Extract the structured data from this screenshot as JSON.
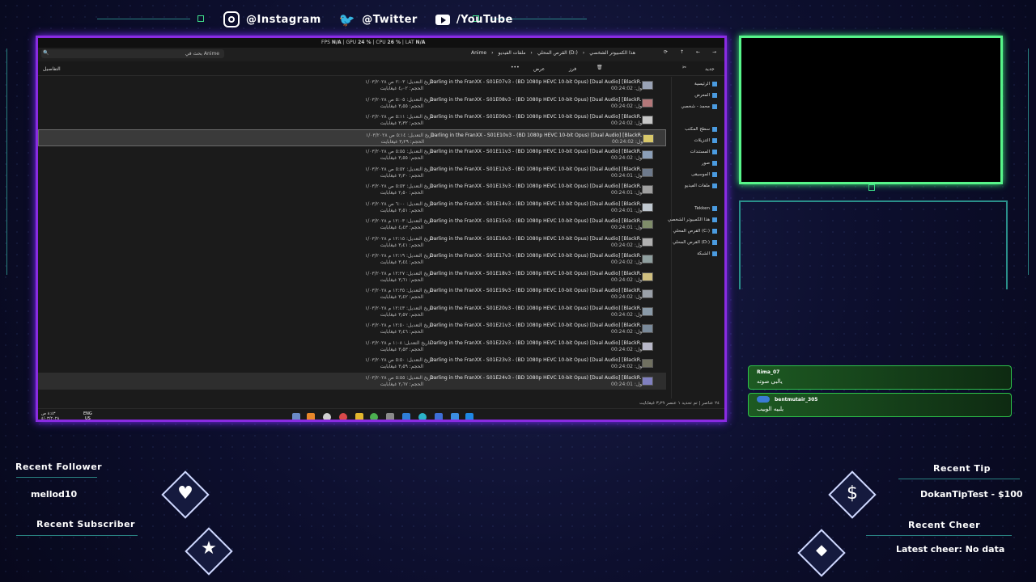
{
  "social": {
    "instagram": "@Instagram",
    "twitter": "@Twitter",
    "youtube": "/YouTube"
  },
  "overlay_colors": {
    "accent_purple": "#8a2be2",
    "accent_green": "#57f58a",
    "chat_green": "#2ec24a"
  },
  "perf": {
    "fps_label": "FPS",
    "fps": "N/A",
    "gpu_label": "GPU",
    "gpu": "24 %",
    "cpu_label": "CPU",
    "cpu": "26 %",
    "lat_label": "LAT",
    "lat": "N/A"
  },
  "explorer": {
    "search_placeholder": "بحث في Anime",
    "breadcrumb": [
      "هذا الكمبيوتر الشخصي",
      "القرص المحلي (D:)",
      "ملفات الفيديو",
      "Anime"
    ],
    "toolbar": {
      "new": "جديد",
      "sort": "فرز",
      "view": "عرض",
      "details": "التفاصيل"
    },
    "rows": [
      {
        "name": "Darling in the FranXX - S01E07v3 - (BD 1080p HEVC 10-bit Opus) [Dual Audio] [BlackR...",
        "len": "الطول: 00:24:02",
        "date": "تاريخ التعديل: ٢:٠٣ ص ١/٠٣/٢٠٢٨",
        "size": "الحجم: ٤٫٠٢ غيغابايت"
      },
      {
        "name": "Darling in the FranXX - S01E08v3 - (BD 1080p HEVC 10-bit Opus) [Dual Audio] [BlackR...",
        "len": "الطول: 00:24:02",
        "date": "تاريخ التعديل: ٥:٠٥ ص ١/٠٣/٢٠٢٨",
        "size": "الحجم: ٣٫٥٥ غيغابايت"
      },
      {
        "name": "Darling in the FranXX - S01E09v3 - (BD 1080p HEVC 10-bit Opus) [Dual Audio] [BlackR...",
        "len": "الطول: 00:24:02",
        "date": "تاريخ التعديل: ٥:١١ ص ١/٠٣/٢٠٢٨",
        "size": "الحجم: ٣٫٣٢ غيغابايت"
      },
      {
        "name": "Darling in the FranXX - S01E10v3 - (BD 1080p HEVC 10-bit Opus) [Dual Audio] [BlackR...",
        "len": "الطول: 00:24:02",
        "date": "تاريخ التعديل: ٥:١٤ ص ١/٠٣/٢٠٢٨",
        "size": "الحجم: ٣٫٢٩ غيغابايت",
        "selected": true
      },
      {
        "name": "Darling in the FranXX - S01E11v3 - (BD 1080p HEVC 10-bit Opus) [Dual Audio] [BlackR...",
        "len": "الطول: 00:24:02",
        "date": "تاريخ التعديل: ٥:٥٥ ص ١/٠٣/٢٠٢٨",
        "size": "الحجم: ٣٫٥٥ غيغابايت"
      },
      {
        "name": "Darling in the FranXX - S01E12v3 - (BD 1080p HEVC 10-bit Opus) [Dual Audio] [BlackR...",
        "len": "الطول: 00:24:01",
        "date": "تاريخ التعديل: ٥:٥٢ ص ١/٠٣/٢٠٢٨",
        "size": "الحجم: ٣٫٣٠ غيغابايت"
      },
      {
        "name": "Darling in the FranXX - S01E13v3 - (BD 1080p HEVC 10-bit Opus) [Dual Audio] [BlackR...",
        "len": "الطول: 00:24:01",
        "date": "تاريخ التعديل: ٥:٥٣ ص ١/٠٣/٢٠٢٨",
        "size": "الحجم: ٢٫٥٠ غيغابايت"
      },
      {
        "name": "Darling in the FranXX - S01E14v3 - (BD 1080p HEVC 10-bit Opus) [Dual Audio] [BlackR...",
        "len": "الطول: 00:24:01",
        "date": "تاريخ التعديل: ٦:٠٠ ص ١/٠٣/٢٠٢٨",
        "size": "الحجم: ٣٫٥١ غيغابايت"
      },
      {
        "name": "Darling in the FranXX - S01E15v3 - (BD 1080p HEVC 10-bit Opus) [Dual Audio] [BlackR...",
        "len": "الطول: 00:24:01",
        "date": "تاريخ التعديل: ١٢:٠٣ م ١/٠٣/٢٠٢٨",
        "size": "الحجم: ٤٫٤٣ غيغابايت"
      },
      {
        "name": "Darling in the FranXX - S01E16v3 - (BD 1080p HEVC 10-bit Opus) [Dual Audio] [BlackR...",
        "len": "الطول: 00:24:02",
        "date": "تاريخ التعديل: ١٢:١٥ م ١/٠٣/٢٠٢٨",
        "size": "الحجم: ٣٫٤١ غيغابايت"
      },
      {
        "name": "Darling in the FranXX - S01E17v3 - (BD 1080p HEVC 10-bit Opus) [Dual Audio] [BlackR...",
        "len": "الطول: 00:24:02",
        "date": "تاريخ التعديل: ١٢:١٩ م ١/٠٣/٢٠٢٨",
        "size": "الحجم: ٣٫٤٤ غيغابايت"
      },
      {
        "name": "Darling in the FranXX - S01E18v3 - (BD 1080p HEVC 10-bit Opus) [Dual Audio] [BlackR...",
        "len": "الطول: 00:24:02",
        "date": "تاريخ التعديل: ١٢:٢٧ م ١/٠٣/٢٠٢٨",
        "size": "الحجم: ٣٫٦١ غيغابايت"
      },
      {
        "name": "Darling in the FranXX - S01E19v3 - (BD 1080p HEVC 10-bit Opus) [Dual Audio] [BlackR...",
        "len": "الطول: 00:24:02",
        "date": "تاريخ التعديل: ١٢:٣٥ م ١/٠٣/٢٠٢٨",
        "size": "الحجم: ٣٫٤٢ غيغابايت"
      },
      {
        "name": "Darling in the FranXX - S01E20v3 - (BD 1080p HEVC 10-bit Opus) [Dual Audio] [BlackR...",
        "len": "الطول: 00:24:02",
        "date": "تاريخ التعديل: ١٢:٤٣ م ١/٠٣/٢٠٢٨",
        "size": "الحجم: ٣٫٥٧ غيغابايت"
      },
      {
        "name": "Darling in the FranXX - S01E21v3 - (BD 1080p HEVC 10-bit Opus) [Dual Audio] [BlackR...",
        "len": "الطول: 00:24:02",
        "date": "تاريخ التعديل: ١٢:٥٠ م ١/٠٣/٢٠٢٨",
        "size": "الحجم: ٣٫٤٦ غيغابايت"
      },
      {
        "name": "Darling in the FranXX - S01E22v3 - (BD 1080p HEVC 10-bit Opus) [Dual Audio] [BlackR...",
        "len": "الطول: 00:24:02",
        "date": "تاريخ التعديل: ١:٠٨ م ١/٠٣/٢٠٢٨",
        "size": "الحجم: ٣٫٥٣ غيغابايت"
      },
      {
        "name": "Darling in the FranXX - S01E23v3 - (BD 1080p HEVC 10-bit Opus) [Dual Audio] [BlackR...",
        "len": "الطول: 00:24:02",
        "date": "تاريخ التعديل: ٥:٥٠ ص ١/٠٣/٢٠٢٨",
        "size": "الحجم: ٣٫٥٩ غيغابايت"
      },
      {
        "name": "Darling in the FranXX - S01E24v3 - (BD 1080p HEVC 10-bit Opus) [Dual Audio] [BlackR...",
        "len": "الطول: 00:24:01",
        "date": "تاريخ التعديل: ٥:٥٥ ص ١/٠٣/٢٠٢٨",
        "size": "الحجم: ٢٫٦٧ غيغابايت",
        "hover": true
      }
    ],
    "sidebar": [
      "الرئيسية",
      "المعرض",
      "محمد - شخصي",
      "سطح المكتب",
      "التنزيلات",
      "المستندات",
      "صور",
      "الموسيقى",
      "ملفات الفيديو",
      "Tekken",
      "هذا الكمبيوتر الشخصي",
      "القرص المحلي (C:)",
      "القرص المحلي (D:)",
      "الشبكة"
    ],
    "status": "٢٤ عناصر | تم تحديد ١ عنصر ٣٫٢٩ غيغابايت",
    "clock_time": "٨:٤٣ ص",
    "clock_date": "٤/٠٣/٢٠٢٨",
    "lang": "ENG",
    "lang_region": "US"
  },
  "chat": [
    {
      "user": "Rima_07",
      "message": "يالبى صوته"
    },
    {
      "user": "bentmutair_305",
      "message": "يلبيه الوبيب"
    }
  ],
  "widgets": {
    "recent_follower_label": "Recent Follower",
    "recent_follower": "mellod10",
    "recent_subscriber_label": "Recent Subscriber",
    "recent_subscriber": "",
    "recent_tip_label": "Recent Tip",
    "recent_tip": "DokanTipTest - $100",
    "recent_cheer_label": "Recent Cheer",
    "recent_cheer": "Latest cheer: No data"
  }
}
